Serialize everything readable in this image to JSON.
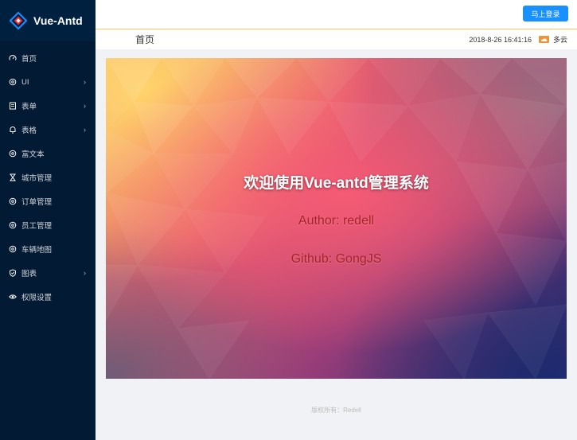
{
  "app": {
    "name": "Vue-Antd"
  },
  "sidebar": {
    "items": [
      {
        "label": "首页",
        "icon": "dashboard-icon",
        "has_submenu": false
      },
      {
        "label": "UI",
        "icon": "setting-icon",
        "has_submenu": true
      },
      {
        "label": "表单",
        "icon": "file-icon",
        "has_submenu": true
      },
      {
        "label": "表格",
        "icon": "bell-icon",
        "has_submenu": true
      },
      {
        "label": "富文本",
        "icon": "setting-icon",
        "has_submenu": false
      },
      {
        "label": "城市管理",
        "icon": "hourglass-icon",
        "has_submenu": false
      },
      {
        "label": "订单管理",
        "icon": "setting-icon",
        "has_submenu": false
      },
      {
        "label": "员工管理",
        "icon": "setting-icon",
        "has_submenu": false
      },
      {
        "label": "车辆地图",
        "icon": "setting-icon",
        "has_submenu": false
      },
      {
        "label": "图表",
        "icon": "shield-check-icon",
        "has_submenu": true
      },
      {
        "label": "权限设置",
        "icon": "eye-icon",
        "has_submenu": false
      }
    ],
    "chevron": "›"
  },
  "header": {
    "login_label": "马上登录"
  },
  "subheader": {
    "title": "首页",
    "datetime": "2018-8-26 16:41:16",
    "weather": "多云",
    "weather_icon": "cloudy-weather-icon"
  },
  "banner": {
    "welcome": "欢迎使用Vue-antd管理系统",
    "author": "Author: redell",
    "github": "Github: GongJS"
  },
  "footer": {
    "copyright": "版权所有：Redell"
  },
  "colors": {
    "sidebar_bg": "#031a34",
    "logo_bg": "#00203f",
    "primary": "#1890ff",
    "content_bg": "#f0f2f5",
    "author_text": "#a5232a",
    "header_border": "#f5c66d"
  }
}
